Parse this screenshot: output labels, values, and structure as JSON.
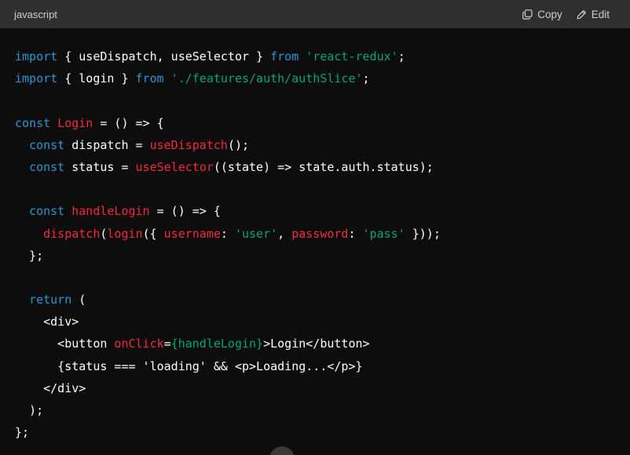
{
  "header": {
    "language": "javascript",
    "copy_label": "Copy",
    "edit_label": "Edit"
  },
  "icons": {
    "copy": "copy-icon",
    "edit": "edit-pencil-icon"
  },
  "colors": {
    "keyword": "#2e95d3",
    "function": "#f22c3d",
    "string": "#00a67d",
    "text": "#ffffff",
    "header_bg": "#2f2f2f",
    "code_bg": "#0d0d0d"
  },
  "code_lines": [
    [
      {
        "t": "kw",
        "v": "import"
      },
      {
        "t": "tx",
        "v": " { useDispatch, useSelector } "
      },
      {
        "t": "kw",
        "v": "from"
      },
      {
        "t": "tx",
        "v": " "
      },
      {
        "t": "str",
        "v": "'react-redux'"
      },
      {
        "t": "tx",
        "v": ";"
      }
    ],
    [
      {
        "t": "kw",
        "v": "import"
      },
      {
        "t": "tx",
        "v": " { login } "
      },
      {
        "t": "kw",
        "v": "from"
      },
      {
        "t": "tx",
        "v": " "
      },
      {
        "t": "str",
        "v": "'./features/auth/authSlice'"
      },
      {
        "t": "tx",
        "v": ";"
      }
    ],
    [],
    [
      {
        "t": "kw",
        "v": "const"
      },
      {
        "t": "tx",
        "v": " "
      },
      {
        "t": "fn",
        "v": "Login"
      },
      {
        "t": "tx",
        "v": " = () => {"
      }
    ],
    [
      {
        "t": "tx",
        "v": "  "
      },
      {
        "t": "kw",
        "v": "const"
      },
      {
        "t": "tx",
        "v": " dispatch = "
      },
      {
        "t": "fn",
        "v": "useDispatch"
      },
      {
        "t": "tx",
        "v": "();"
      }
    ],
    [
      {
        "t": "tx",
        "v": "  "
      },
      {
        "t": "kw",
        "v": "const"
      },
      {
        "t": "tx",
        "v": " status = "
      },
      {
        "t": "fn",
        "v": "useSelector"
      },
      {
        "t": "tx",
        "v": "((state) => state.auth.status);"
      }
    ],
    [],
    [
      {
        "t": "tx",
        "v": "  "
      },
      {
        "t": "kw",
        "v": "const"
      },
      {
        "t": "tx",
        "v": " "
      },
      {
        "t": "fn",
        "v": "handleLogin"
      },
      {
        "t": "tx",
        "v": " = () => {"
      }
    ],
    [
      {
        "t": "tx",
        "v": "    "
      },
      {
        "t": "fn",
        "v": "dispatch"
      },
      {
        "t": "tx",
        "v": "("
      },
      {
        "t": "fn",
        "v": "login"
      },
      {
        "t": "tx",
        "v": "({ "
      },
      {
        "t": "fn",
        "v": "username"
      },
      {
        "t": "tx",
        "v": ": "
      },
      {
        "t": "str",
        "v": "'user'"
      },
      {
        "t": "tx",
        "v": ", "
      },
      {
        "t": "fn",
        "v": "password"
      },
      {
        "t": "tx",
        "v": ": "
      },
      {
        "t": "str",
        "v": "'pass'"
      },
      {
        "t": "tx",
        "v": " }));"
      }
    ],
    [
      {
        "t": "tx",
        "v": "  };"
      }
    ],
    [],
    [
      {
        "t": "tx",
        "v": "  "
      },
      {
        "t": "kw",
        "v": "return"
      },
      {
        "t": "tx",
        "v": " ("
      }
    ],
    [
      {
        "t": "tx",
        "v": "    <div>"
      }
    ],
    [
      {
        "t": "tx",
        "v": "      <button "
      },
      {
        "t": "fn",
        "v": "onClick"
      },
      {
        "t": "tx",
        "v": "="
      },
      {
        "t": "str",
        "v": "{handleLogin}"
      },
      {
        "t": "tx",
        "v": ">Login</button>"
      }
    ],
    [
      {
        "t": "tx",
        "v": "      {status === 'loading' && <p>Loading...</p>}"
      }
    ],
    [
      {
        "t": "tx",
        "v": "    </div>"
      }
    ],
    [
      {
        "t": "tx",
        "v": "  );"
      }
    ],
    [
      {
        "t": "tx",
        "v": "};"
      }
    ]
  ]
}
